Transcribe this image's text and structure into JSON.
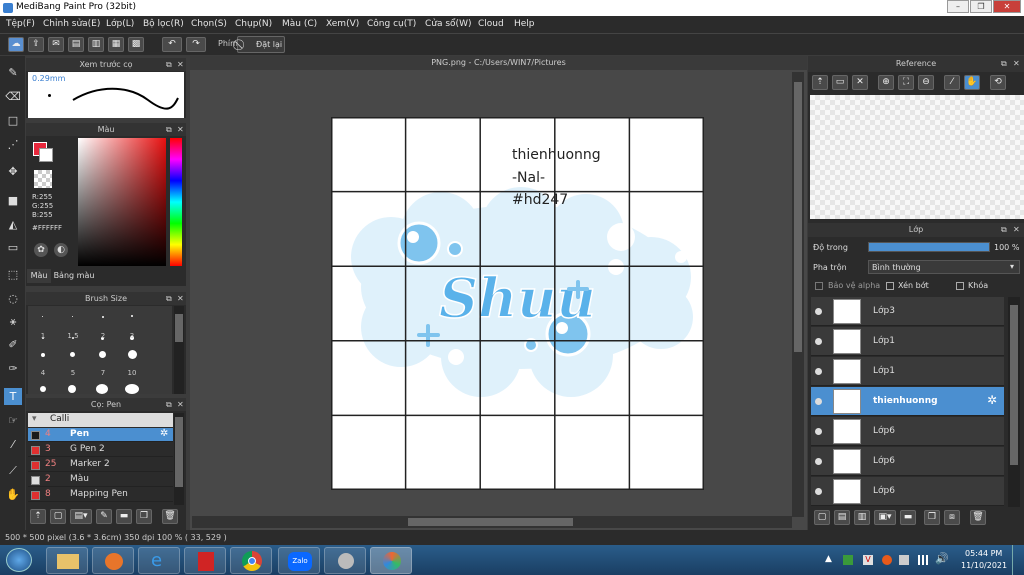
{
  "window": {
    "title": "MediBang Paint Pro (32bit)"
  },
  "menu": [
    "Tệp(F)",
    "Chỉnh sửa(E)",
    "Lớp(L)",
    "Bộ lọc(R)",
    "Chọn(S)",
    "Chụp(N)",
    "Màu (C)",
    "Xem(V)",
    "Công cụ(T)",
    "Cửa sổ(W)",
    "Cloud",
    "Help"
  ],
  "toolbar": {
    "key_label": "Phím",
    "reset_label": "Đặt lại"
  },
  "preview": {
    "title": "Xem trước cọ",
    "size": "0.29mm"
  },
  "color": {
    "title": "Màu",
    "r": "R:255",
    "g": "G:255",
    "b": "B:255",
    "hex": "#FFFFFF",
    "tab1": "Màu",
    "tab2": "Bảng màu",
    "accent": "#e8283c"
  },
  "brushsize": {
    "title": "Brush Size",
    "sizes": [
      "1",
      "1.5",
      "2",
      "3",
      "4",
      "5",
      "7",
      "10"
    ]
  },
  "pen": {
    "title": "Cọ: Pen",
    "group": "Calli",
    "items": [
      {
        "size": "4",
        "name": "Pen",
        "color": "#1a1a1a"
      },
      {
        "size": "3",
        "name": "G Pen 2",
        "color": "#e03030"
      },
      {
        "size": "25",
        "name": "Marker 2",
        "color": "#e03030"
      },
      {
        "size": "2",
        "name": "Màu",
        "color": "#dddddd"
      },
      {
        "size": "8",
        "name": "Mapping Pen",
        "color": "#e03030"
      }
    ]
  },
  "document": {
    "tab": "PNG.png - C:/Users/WIN7/Pictures",
    "text1": "thienhuonng",
    "text2": "-Nal-",
    "text3": "#hd247",
    "art_word": "Shuu"
  },
  "reference": {
    "title": "Reference"
  },
  "layers": {
    "title": "Lớp",
    "opacity_label": "Độ trong",
    "opacity_value": "100 %",
    "opacity_fraction": 1.0,
    "blend_label": "Pha trộn",
    "blend_value": "Bình thường",
    "protect_alpha": "Bảo vệ alpha",
    "clip": "Xén bớt",
    "lock": "Khóa",
    "items": [
      {
        "name": "Lớp3"
      },
      {
        "name": "Lớp1"
      },
      {
        "name": "Lớp1"
      },
      {
        "name": "thienhuonng"
      },
      {
        "name": "Lớp6"
      },
      {
        "name": "Lớp6"
      },
      {
        "name": "Lớp6"
      }
    ]
  },
  "status": {
    "text": "500 * 500 pixel   (3.6 * 3.6cm)   350 dpi   100 %   ( 33, 529 )"
  },
  "taskbar": {
    "time": "05:44 PM",
    "date": "11/10/2021",
    "zalo": "Zalo"
  }
}
